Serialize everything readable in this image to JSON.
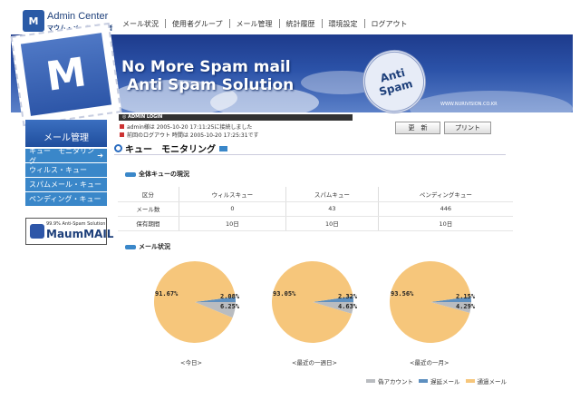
{
  "app": {
    "logo_mark": "M",
    "title": "Admin Center",
    "subtitle": "マウム・メール 管理者"
  },
  "topnav": [
    "メール状況",
    "使用者グループ",
    "メール管理",
    "統計履歴",
    "環境設定",
    "ログアウト"
  ],
  "banner": {
    "stamp_left": "M",
    "line1": "No More Spam mail",
    "line2": "Anti Spam Solution",
    "stamp_right_1": "Anti",
    "stamp_right_2": "Spam",
    "url": "WWW.NURIVISION.CO.KR"
  },
  "sidebar": {
    "header": "メール管理",
    "items": [
      {
        "label": "キュー　モニタリング",
        "active": true
      },
      {
        "label": "ウィルス・キュー"
      },
      {
        "label": "スパムメール・キュー"
      },
      {
        "label": "ペンディング・キュー"
      }
    ],
    "brand_small": "99.9% Anti-Spam Solution",
    "brand_name": "MaumMAIL"
  },
  "admin": {
    "bar": "◎ ADMIN LOGIN",
    "line1": "admin様は 2005-10-20 17:11:25に接続しました",
    "line2": "前回のログアウト 時間は 2005-10-20 17:25:31です"
  },
  "buttons": {
    "refresh": "更　新",
    "print": "プリント"
  },
  "page_title": "キュー　モニタリング",
  "sections": {
    "overall": "全体キューの現況",
    "mail": "メール状況"
  },
  "table": {
    "headers": [
      "区分",
      "ウィルスキュー",
      "スパムキュー",
      "ペンディングキュー"
    ],
    "rows": [
      [
        "メール数",
        "0",
        "43",
        "446"
      ],
      [
        "保有期間",
        "10日",
        "10日",
        "10日"
      ]
    ]
  },
  "chart_data": [
    {
      "type": "pie",
      "title": "<今日>",
      "labels": [
        "偽アカウント",
        "遅延メール",
        "通過メール"
      ],
      "values": [
        6.25,
        2.08,
        91.67
      ],
      "value_labels": [
        "6.25%",
        "2.08%",
        "91.67%"
      ],
      "colors": [
        "#b9bcc0",
        "#5d8fbf",
        "#f6c67b"
      ]
    },
    {
      "type": "pie",
      "title": "<最近の一週日>",
      "labels": [
        "偽アカウント",
        "遅延メール",
        "通過メール"
      ],
      "values": [
        4.63,
        2.32,
        93.05
      ],
      "value_labels": [
        "4.63%",
        "2.32%",
        "93.05%"
      ],
      "colors": [
        "#b9bcc0",
        "#5d8fbf",
        "#f6c67b"
      ]
    },
    {
      "type": "pie",
      "title": "<最近の一月>",
      "labels": [
        "偽アカウント",
        "遅延メール",
        "通過メール"
      ],
      "values": [
        4.29,
        2.15,
        93.56
      ],
      "value_labels": [
        "4.29%",
        "2.15%",
        "93.56%"
      ],
      "colors": [
        "#b9bcc0",
        "#5d8fbf",
        "#f6c67b"
      ]
    }
  ],
  "legend": [
    {
      "label": "偽アカウント",
      "color": "#b9bcc0"
    },
    {
      "label": "遅延メール",
      "color": "#5d8fbf"
    },
    {
      "label": "通過メール",
      "color": "#f6c67b"
    }
  ]
}
